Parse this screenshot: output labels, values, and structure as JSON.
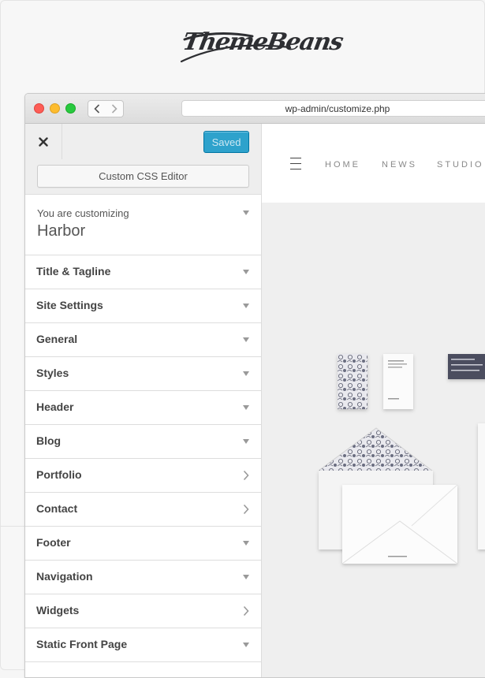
{
  "brand": {
    "logo_text": "ThemeBeans"
  },
  "browser": {
    "url": "wp-admin/customize.php",
    "controls": [
      "close-dot",
      "minimize-dot",
      "zoom-dot"
    ],
    "nav_icons": {
      "back": "chevron-left-icon",
      "forward": "chevron-right-icon"
    }
  },
  "customizer": {
    "close_icon": "close-icon",
    "saved_label": "Saved",
    "css_editor_label": "Custom CSS Editor",
    "customizing_label": "You are customizing",
    "theme_name": "Harbor",
    "sections": [
      {
        "label": "Title & Tagline",
        "icon": "chevron-down-icon"
      },
      {
        "label": "Site Settings",
        "icon": "chevron-down-icon"
      },
      {
        "label": "General",
        "icon": "chevron-down-icon"
      },
      {
        "label": "Styles",
        "icon": "chevron-down-icon"
      },
      {
        "label": "Header",
        "icon": "chevron-down-icon"
      },
      {
        "label": "Blog",
        "icon": "chevron-down-icon"
      },
      {
        "label": "Portfolio",
        "icon": "chevron-right-icon"
      },
      {
        "label": "Contact",
        "icon": "chevron-right-icon"
      },
      {
        "label": "Footer",
        "icon": "chevron-down-icon"
      },
      {
        "label": "Navigation",
        "icon": "chevron-down-icon"
      },
      {
        "label": "Widgets",
        "icon": "chevron-right-icon"
      },
      {
        "label": "Static Front Page",
        "icon": "chevron-down-icon"
      }
    ]
  },
  "preview": {
    "menu_icon": "hamburger-menu-icon",
    "nav": [
      "HOME",
      "NEWS",
      "STUDIO"
    ]
  },
  "colors": {
    "saved_button": "#2ea2cc",
    "sidebar_header": "#eeeeee",
    "preview_bg": "#efefef"
  }
}
